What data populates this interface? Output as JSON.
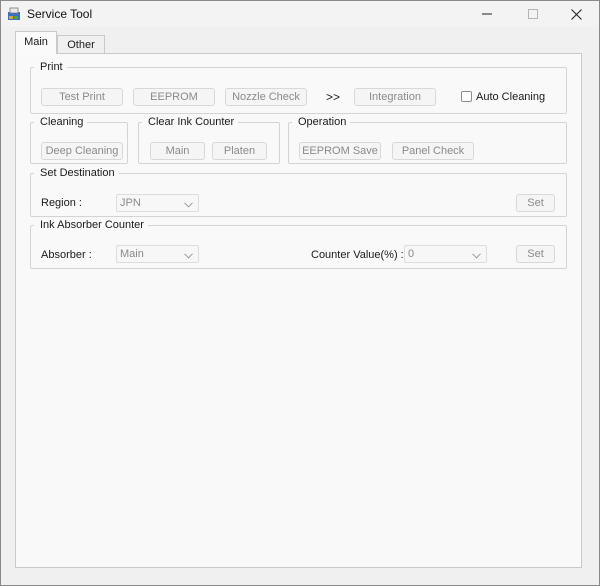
{
  "window": {
    "title": "Service Tool"
  },
  "tabs": {
    "main": "Main",
    "other": "Other"
  },
  "print": {
    "legend": "Print",
    "test_print": "Test Print",
    "eeprom": "EEPROM",
    "nozzle_check": "Nozzle Check",
    "arrow": ">>",
    "integration": "Integration",
    "auto_cleaning": "Auto Cleaning"
  },
  "cleaning": {
    "legend": "Cleaning",
    "deep_cleaning": "Deep Cleaning"
  },
  "clear_ink_counter": {
    "legend": "Clear Ink Counter",
    "main": "Main",
    "platen": "Platen"
  },
  "operation": {
    "legend": "Operation",
    "eeprom_save": "EEPROM Save",
    "panel_check": "Panel Check"
  },
  "set_destination": {
    "legend": "Set Destination",
    "region_label": "Region :",
    "region_value": "JPN",
    "set": "Set"
  },
  "ink_absorber_counter": {
    "legend": "Ink Absorber Counter",
    "absorber_label": "Absorber :",
    "absorber_value": "Main",
    "counter_label": "Counter Value(%) :",
    "counter_value": "0",
    "set": "Set"
  },
  "colors": {
    "disabled_text": "#8a8a8a",
    "panel_bg": "#f9f9f9",
    "window_bg": "#f0f0f0"
  }
}
